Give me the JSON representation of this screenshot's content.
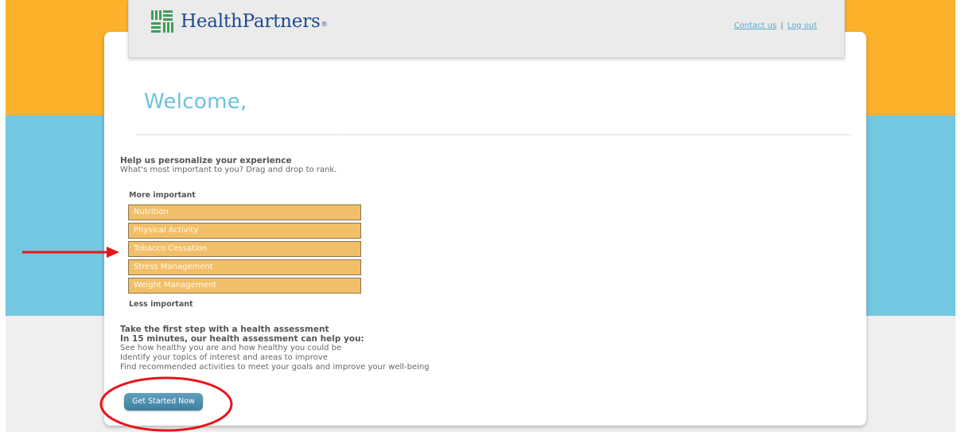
{
  "brand": {
    "name": "HealthPartners",
    "reg_mark": "®"
  },
  "header": {
    "contact_label": "Contact us",
    "separator": "|",
    "logout_label": "Log out"
  },
  "welcome": {
    "text": "Welcome,"
  },
  "personalize": {
    "title": "Help us personalize your experience",
    "subtitle": "What's most important to you? Drag and drop to rank.",
    "more_label": "More important",
    "less_label": "Less important",
    "items": [
      {
        "label": "Nutrition"
      },
      {
        "label": "Physical Activity"
      },
      {
        "label": "Tobacco Cessation"
      },
      {
        "label": "Stress Management"
      },
      {
        "label": "Weight Management"
      }
    ]
  },
  "assessment": {
    "title": "Take the first step with a health assessment",
    "subtitle": "In 15 minutes, our health assessment can help you:",
    "lines": [
      "See how healthy you are and how healthy you could be",
      "Identify your topics of interest and areas to improve",
      "Find recommended activities to meet your goals and improve your well-being"
    ],
    "cta_label": "Get Started Now"
  },
  "colors": {
    "orange_band": "#fbb12a",
    "blue_band": "#72c7e1",
    "rank_item": "#f2bf69",
    "welcome_text": "#6cc3dd",
    "button": "#4d8fb0",
    "annotation": "#e8141b"
  },
  "annotations": {
    "arrow_icon": "red-arrow",
    "circle_icon": "red-ellipse"
  }
}
